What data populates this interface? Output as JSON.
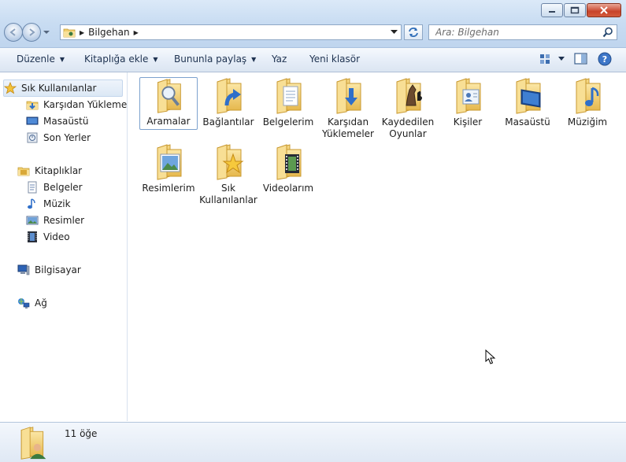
{
  "window": {
    "title_buttons": [
      "minimize",
      "maximize",
      "close"
    ]
  },
  "address": {
    "crumbs": [
      "Bilgehan"
    ],
    "search_placeholder": "Ara: Bilgehan"
  },
  "toolbar": {
    "organize": "Düzenle",
    "include_library": "Kitaplığa ekle",
    "share": "Bununla paylaş",
    "burn": "Yaz",
    "new_folder": "Yeni klasör"
  },
  "nav": {
    "favorites": "Sık Kullanılanlar",
    "downloads": "Karşıdan Yüklemeler",
    "desktop": "Masaüstü",
    "recent": "Son Yerler",
    "libraries": "Kitaplıklar",
    "documents": "Belgeler",
    "music": "Müzik",
    "pictures": "Resimler",
    "videos": "Video",
    "computer": "Bilgisayar",
    "network": "Ağ"
  },
  "items": [
    {
      "label": "Aramalar",
      "icon": "searches-folder-icon"
    },
    {
      "label": "Bağlantılar",
      "icon": "links-folder-icon"
    },
    {
      "label": "Belgelerim",
      "icon": "documents-folder-icon"
    },
    {
      "label": "Karşıdan Yüklemeler",
      "icon": "downloads-folder-icon"
    },
    {
      "label": "Kaydedilen Oyunlar",
      "icon": "saved-games-folder-icon"
    },
    {
      "label": "Kişiler",
      "icon": "contacts-folder-icon"
    },
    {
      "label": "Masaüstü",
      "icon": "desktop-folder-icon"
    },
    {
      "label": "Müziğim",
      "icon": "music-folder-icon"
    },
    {
      "label": "Resimlerim",
      "icon": "pictures-folder-icon"
    },
    {
      "label": "Sık Kullanılanlar",
      "icon": "favorites-folder-icon"
    },
    {
      "label": "Videolarım",
      "icon": "videos-folder-icon"
    }
  ],
  "status": {
    "count": "11 öğe"
  },
  "colors": {
    "folder": "#f3d27a",
    "folder_dark": "#d9a838",
    "accent": "#2e6fc9"
  }
}
